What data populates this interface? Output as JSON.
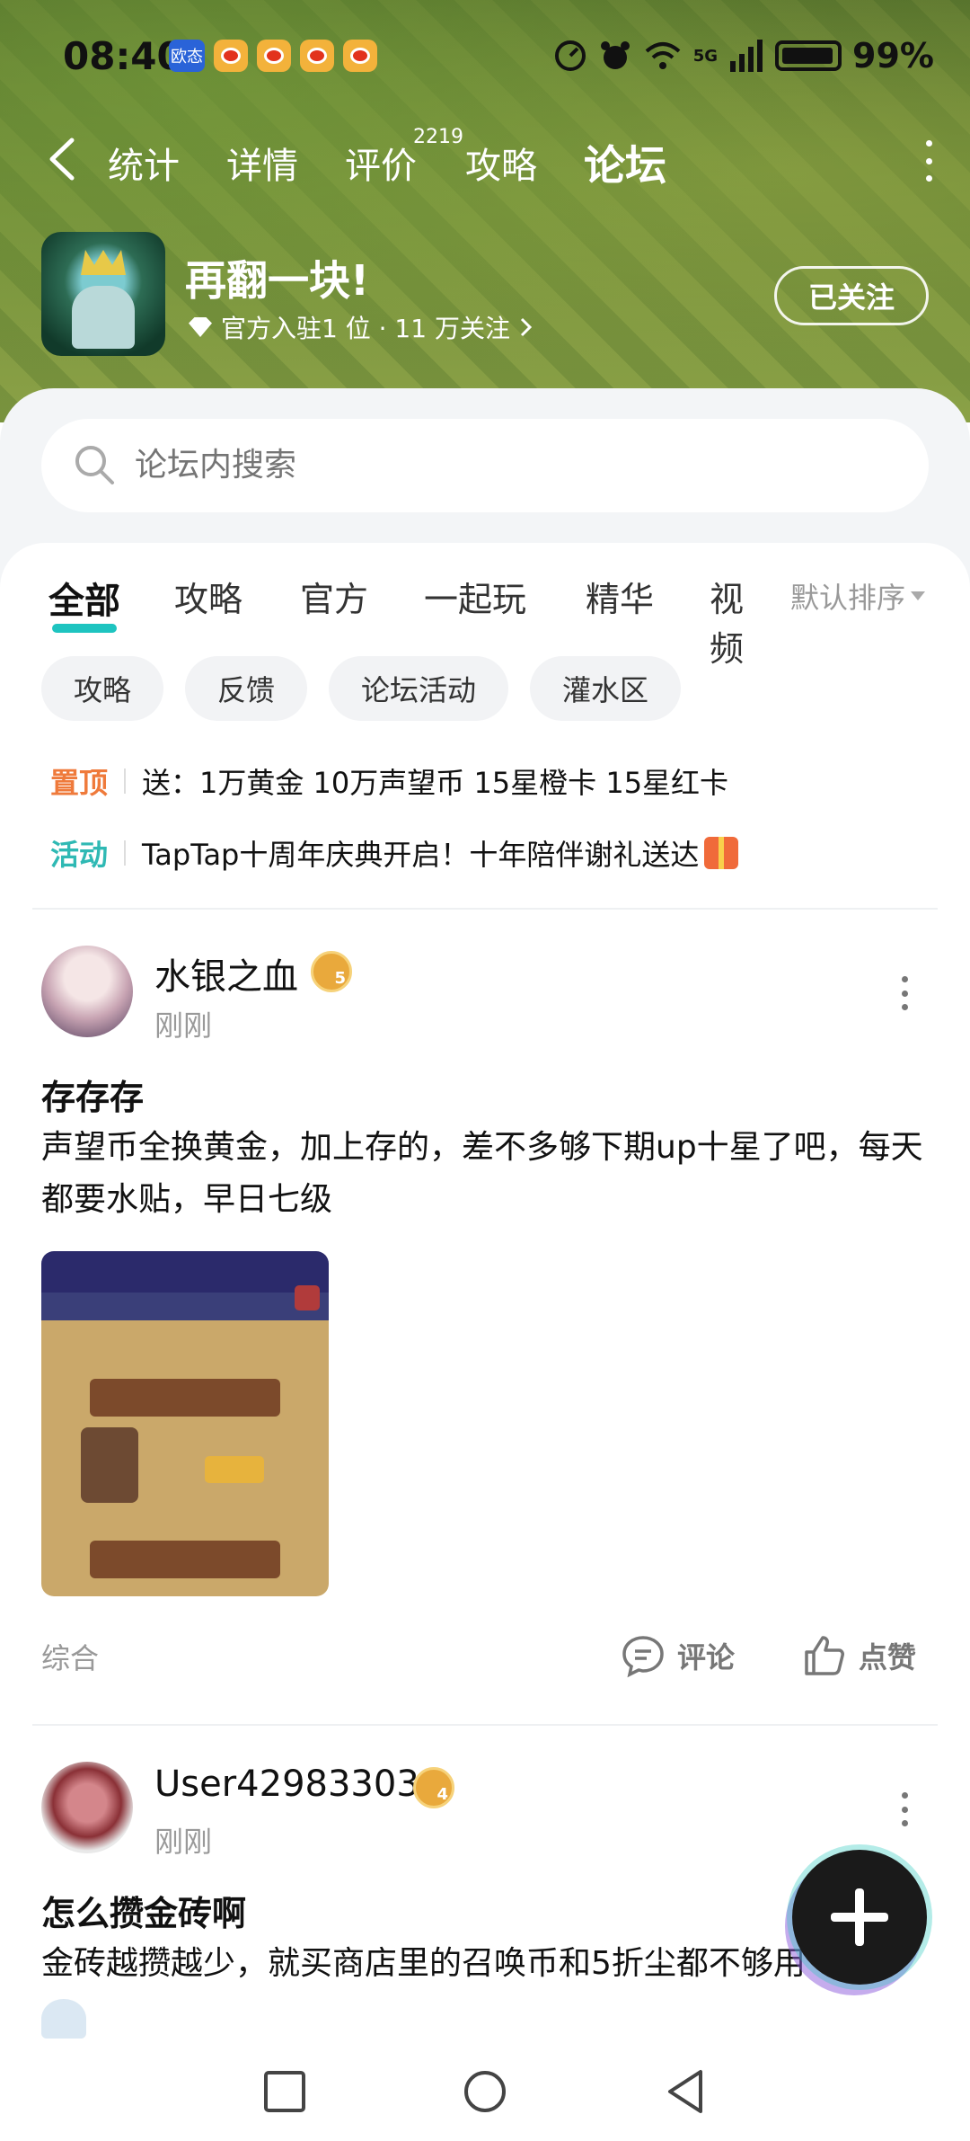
{
  "status_bar": {
    "time": "08:40",
    "badge": "欧态",
    "network": "5G",
    "battery": "99%"
  },
  "nav": {
    "tabs": [
      "统计",
      "详情",
      "评价",
      "攻略",
      "论坛"
    ],
    "review_count": "2219",
    "active_tab": "论坛"
  },
  "game": {
    "title": "再翻一块!",
    "meta": "官方入驻1 位 · 11 万关注",
    "follow_label": "已关注"
  },
  "search": {
    "placeholder": "论坛内搜索"
  },
  "categories": {
    "tabs": [
      "全部",
      "攻略",
      "官方",
      "一起玩",
      "精华"
    ],
    "clipped": "视频",
    "sort_label": "默认排序"
  },
  "chips": [
    "攻略",
    "反馈",
    "论坛活动",
    "灌水区"
  ],
  "notices": [
    {
      "tag": "置顶",
      "text": "送：1万黄金 10万声望币 15星橙卡 15星红卡"
    },
    {
      "tag": "活动",
      "text": "TapTap十周年庆典开启！十年陪伴谢礼送达"
    }
  ],
  "posts": [
    {
      "user": "水银之血",
      "level": "5",
      "time": "刚刚",
      "title": "存存存",
      "body": "声望币全换黄金，加上存的，差不多够下期up十星了吧，每天都要水贴，早日七级",
      "category": "综合",
      "comment_label": "评论",
      "like_label": "点赞"
    },
    {
      "user": "User42983303",
      "level": "4",
      "time": "刚刚",
      "title": "怎么攒金砖啊",
      "body": "金砖越攒越少，就买商店里的召唤币和5折尘都不够用"
    }
  ],
  "colors": {
    "accent": "#1ec4c0",
    "pin_tag": "#ef7a3b",
    "activity_tag": "#2fb9b4"
  },
  "icons": {
    "back": "chevron-left-icon",
    "more": "kebab-icon",
    "search": "search-icon",
    "comment": "comment-icon",
    "like": "thumb-up-icon",
    "fab": "plus-icon",
    "sysnav": [
      "square-icon",
      "circle-icon",
      "triangle-back-icon"
    ]
  }
}
